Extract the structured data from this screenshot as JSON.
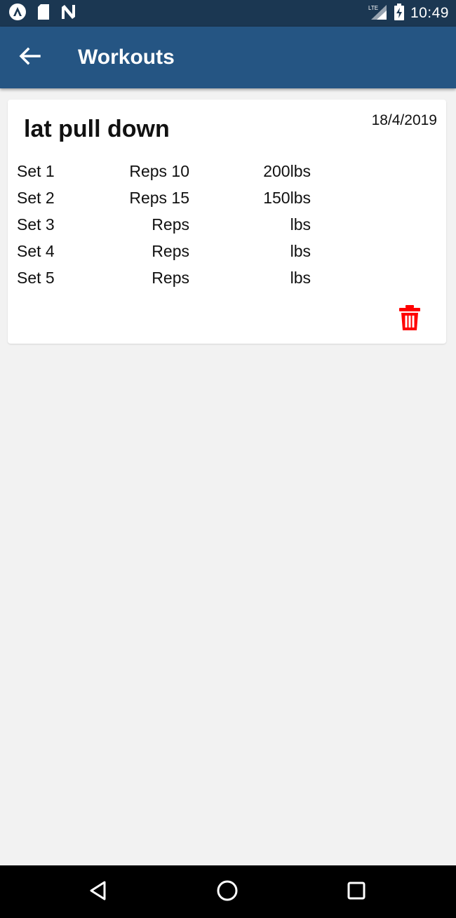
{
  "status_bar": {
    "time": "10:49",
    "left_icons": [
      "app-notification-icon",
      "sd-card-icon",
      "nfc-n-icon"
    ],
    "right_icons": [
      "signal-icon",
      "battery-icon"
    ]
  },
  "app_bar": {
    "title": "Workouts",
    "back_icon": "arrow-back-icon",
    "background_color": "#255583"
  },
  "workout": {
    "name": "lat pull down",
    "date": "18/4/2019",
    "sets": [
      {
        "label": "Set 1",
        "reps": "Reps 10",
        "weight": "200lbs"
      },
      {
        "label": "Set 2",
        "reps": "Reps 15",
        "weight": "150lbs"
      },
      {
        "label": "Set 3",
        "reps": "Reps",
        "weight": "lbs"
      },
      {
        "label": "Set 4",
        "reps": "Reps",
        "weight": "lbs"
      },
      {
        "label": "Set 5",
        "reps": "Reps",
        "weight": "lbs"
      }
    ],
    "delete_icon": "trash-icon",
    "delete_color": "#ff0000"
  },
  "nav_bar": {
    "buttons": [
      "back-triangle-icon",
      "home-circle-icon",
      "recents-square-icon"
    ]
  }
}
